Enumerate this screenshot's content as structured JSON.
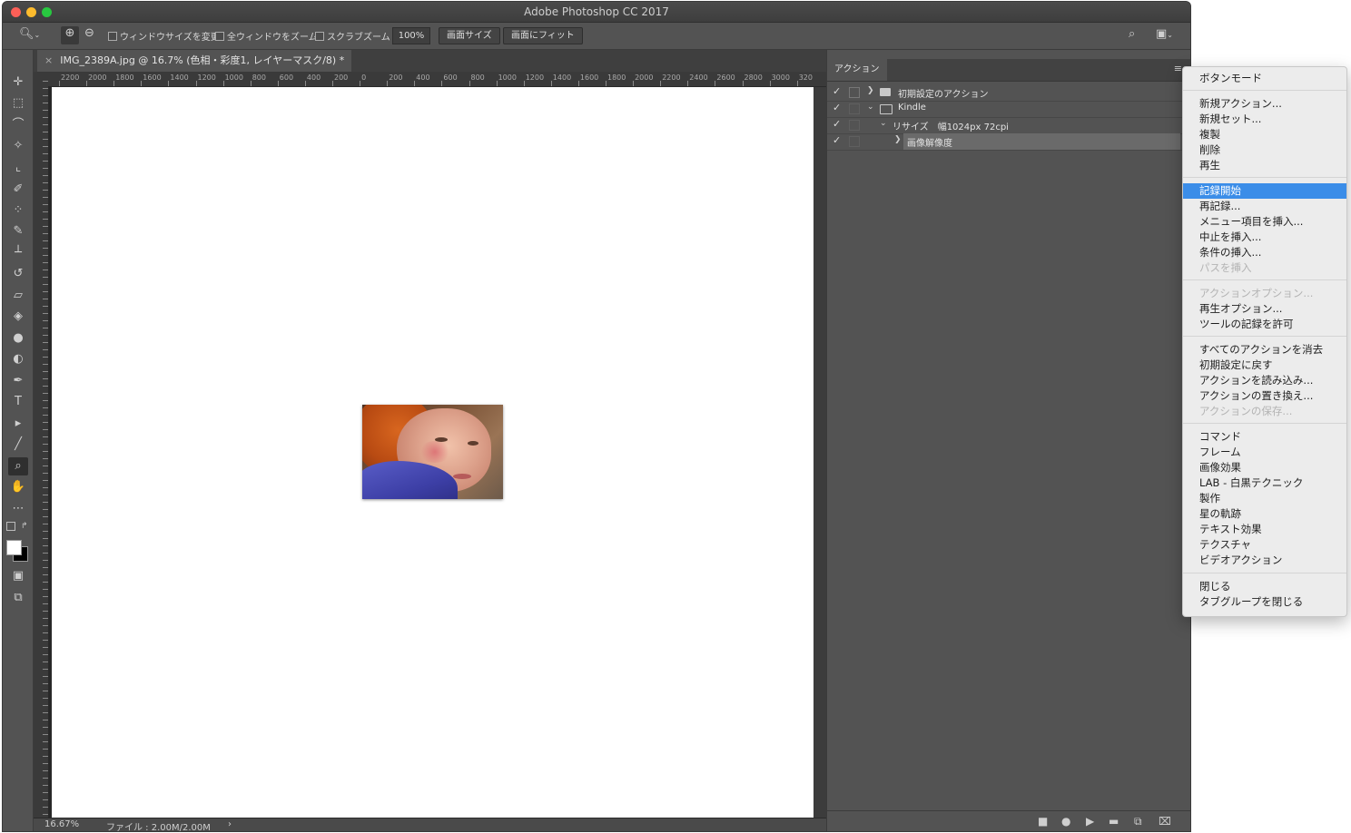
{
  "app": {
    "title": "Adobe Photoshop CC 2017"
  },
  "options_bar": {
    "checkbox_resize": "ウィンドウサイズを変更",
    "checkbox_zoom_all": "全ウィンドウをズーム",
    "checkbox_scrubby": "スクラブズーム",
    "zoom_value": "100%",
    "btn_actual": "画面サイズ",
    "btn_fit": "画面にフィット"
  },
  "document": {
    "tab_title": "IMG_2389A.jpg @ 16.7% (色相・彩度1, レイヤーマスク/8) *",
    "ruler_labels": [
      "2200",
      "2000",
      "1800",
      "1600",
      "1400",
      "1200",
      "1000",
      "800",
      "600",
      "400",
      "200",
      "0",
      "200",
      "400",
      "600",
      "800",
      "1000",
      "1200",
      "1400",
      "1600",
      "1800",
      "2000",
      "2200",
      "2400",
      "2600",
      "2800",
      "3000",
      "320"
    ]
  },
  "status_bar": {
    "zoom": "16.67%",
    "file_info": "ファイル : 2.00M/2.00M"
  },
  "actions_panel": {
    "tab_label": "アクション",
    "rows": [
      {
        "name": "初期設定のアクション",
        "checked": true
      },
      {
        "name": "Kindle",
        "checked": true
      },
      {
        "name": "リサイズ　幅1024px 72cpi",
        "checked": true
      },
      {
        "name": "画像解像度",
        "checked": true
      }
    ]
  },
  "flyout_menu": {
    "groups": [
      [
        "ボタンモード"
      ],
      [
        "新規アクション...",
        "新規セット...",
        "複製",
        "削除",
        "再生"
      ],
      [
        "記録開始",
        "再記録...",
        "メニュー項目を挿入...",
        "中止を挿入...",
        "条件の挿入...",
        "パスを挿入"
      ],
      [
        "アクションオプション...",
        "再生オプション...",
        "ツールの記録を許可"
      ],
      [
        "すべてのアクションを消去",
        "初期設定に戻す",
        "アクションを読み込み...",
        "アクションの置き換え...",
        "アクションの保存..."
      ],
      [
        "コマンド",
        "フレーム",
        "画像効果",
        "LAB - 白黒テクニック",
        "製作",
        "星の軌跡",
        "テキスト効果",
        "テクスチャ",
        "ビデオアクション"
      ],
      [
        "閉じる",
        "タブグループを閉じる"
      ]
    ],
    "highlighted": "記録開始",
    "disabled": [
      "パスを挿入",
      "アクションオプション...",
      "アクションの保存..."
    ]
  },
  "icons": {
    "tools": [
      "move-icon",
      "marquee-icon",
      "lasso-icon",
      "magic-wand-icon",
      "crop-icon",
      "eyedropper-icon",
      "healing-icon",
      "brush-icon",
      "stamp-icon",
      "history-brush-icon",
      "eraser-icon",
      "paint-bucket-icon",
      "blur-icon",
      "dodge-icon",
      "pen-icon",
      "type-icon",
      "path-select-icon",
      "line-icon",
      "zoom-icon",
      "hand-icon",
      "more-icon"
    ]
  },
  "colors": {
    "accent": "#3b8de8",
    "panel": "#535353",
    "canvas_bg": "#282828"
  }
}
